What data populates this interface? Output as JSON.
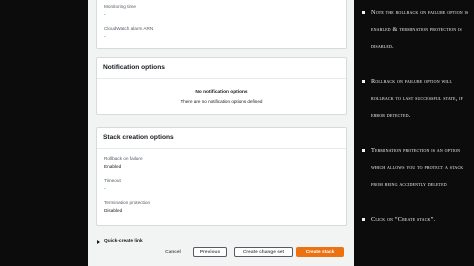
{
  "top_panel": {
    "monitoring_time": {
      "label": "Monitoring time",
      "value": "-"
    },
    "cloudwatch_alarm_arn": {
      "label": "CloudWatch alarm ARN",
      "value": "-"
    }
  },
  "notification_options": {
    "title": "Notification options",
    "empty_title": "No notification options",
    "empty_description": "There are no notification options defined"
  },
  "stack_creation_options": {
    "title": "Stack creation options",
    "rollback_on_failure": {
      "label": "Rollback on failure",
      "value": "Enabled"
    },
    "timeout": {
      "label": "Timeout",
      "value": "-"
    },
    "termination_protection": {
      "label": "Termination protection",
      "value": "Disabled"
    }
  },
  "quick_create_link": "Quick-create link",
  "footer": {
    "cancel": "Cancel",
    "previous": "Previous",
    "create_change_set": "Create change set",
    "create_stack": "Create stack"
  },
  "colors": {
    "primary_button": "#ec7211",
    "background_dark": "#0c0c0c",
    "console_background": "#f2f3f3"
  },
  "notes": [
    "Note the rollback on failure option is enabled & termination protection is disabled.",
    "Rollback on failure option will rollback to last successful state, if error detected.",
    "Termination protection is an option which allows you to protect a stack from being accidently deleted",
    "Click on “Create stack”."
  ]
}
